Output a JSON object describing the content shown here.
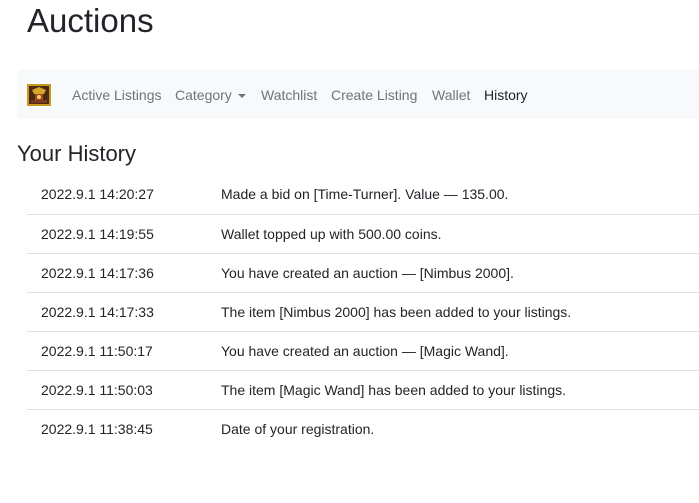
{
  "page": {
    "title": "Auctions"
  },
  "navbar": {
    "brand_icon": "auction-logo-icon",
    "items": [
      {
        "label": "Active Listings",
        "active": false
      },
      {
        "label": "Category",
        "active": false,
        "dropdown": true
      },
      {
        "label": "Watchlist",
        "active": false
      },
      {
        "label": "Create Listing",
        "active": false
      },
      {
        "label": "Wallet",
        "active": false
      },
      {
        "label": "History",
        "active": true
      }
    ]
  },
  "history": {
    "heading": "Your History",
    "rows": [
      {
        "time": "2022.9.1 14:20:27",
        "event": "Made a bid on [Time-Turner]. Value — 135.00."
      },
      {
        "time": "2022.9.1 14:19:55",
        "event": "Wallet topped up with 500.00 coins."
      },
      {
        "time": "2022.9.1 14:17:36",
        "event": "You have created an auction — [Nimbus 2000]."
      },
      {
        "time": "2022.9.1 14:17:33",
        "event": "The item [Nimbus 2000] has been added to your listings."
      },
      {
        "time": "2022.9.1 11:50:17",
        "event": "You have created an auction — [Magic Wand]."
      },
      {
        "time": "2022.9.1 11:50:03",
        "event": "The item [Magic Wand] has been added to your listings."
      },
      {
        "time": "2022.9.1 11:38:45",
        "event": "Date of your registration."
      }
    ]
  },
  "colors": {
    "navbar_bg": "#f8f9fa",
    "nav_link": "#6c757d",
    "nav_link_active": "#212529",
    "row_border": "#dee2e6",
    "brand_border": "#c99a1a"
  }
}
